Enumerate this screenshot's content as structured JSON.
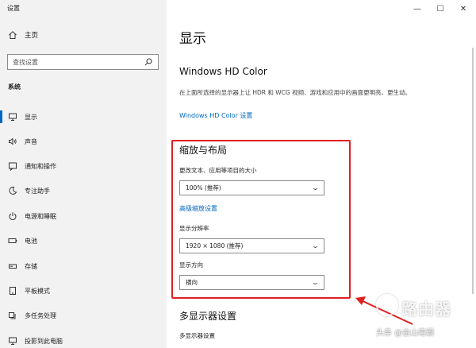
{
  "window": {
    "title": "设置"
  },
  "window_controls": {
    "minimize": "—",
    "maximize": "☐",
    "close": "✕"
  },
  "sidebar": {
    "home": "主页",
    "search": {
      "placeholder": "查找设置"
    },
    "section": "系统",
    "items": [
      {
        "label": "显示",
        "icon": "monitor-icon",
        "active": true
      },
      {
        "label": "声音",
        "icon": "speaker-icon"
      },
      {
        "label": "通知和操作",
        "icon": "notification-icon"
      },
      {
        "label": "专注助手",
        "icon": "moon-icon"
      },
      {
        "label": "电源和睡眠",
        "icon": "power-icon"
      },
      {
        "label": "电池",
        "icon": "battery-icon"
      },
      {
        "label": "存储",
        "icon": "storage-icon"
      },
      {
        "label": "平板模式",
        "icon": "tablet-icon"
      },
      {
        "label": "多任务处理",
        "icon": "multitask-icon"
      },
      {
        "label": "投影到此电脑",
        "icon": "project-icon"
      }
    ]
  },
  "main": {
    "page_title": "显示",
    "hdr": {
      "heading": "Windows HD Color",
      "description": "在上面所选择的显示器上让 HDR 和 WCG 视频、游戏和应用中的画面更明亮、更生动。",
      "link": "Windows HD Color 设置"
    },
    "scale": {
      "heading": "缩放与布局",
      "text_size_label": "更改文本、应用等项目的大小",
      "text_size_value": "100% (推荐)",
      "advanced_link": "高级缩放设置",
      "resolution_label": "显示分辨率",
      "resolution_value": "1920 × 1080 (推荐)",
      "orientation_label": "显示方向",
      "orientation_value": "横向"
    },
    "multi": {
      "heading": "多显示器设置",
      "label": "多显示器设置"
    }
  },
  "watermark": {
    "brand": "路由器",
    "credit": "头条 @金山毒霸"
  },
  "colors": {
    "accent": "#0067c0",
    "highlight": "#e02020",
    "sidebar_bg": "#f2f2f2"
  }
}
